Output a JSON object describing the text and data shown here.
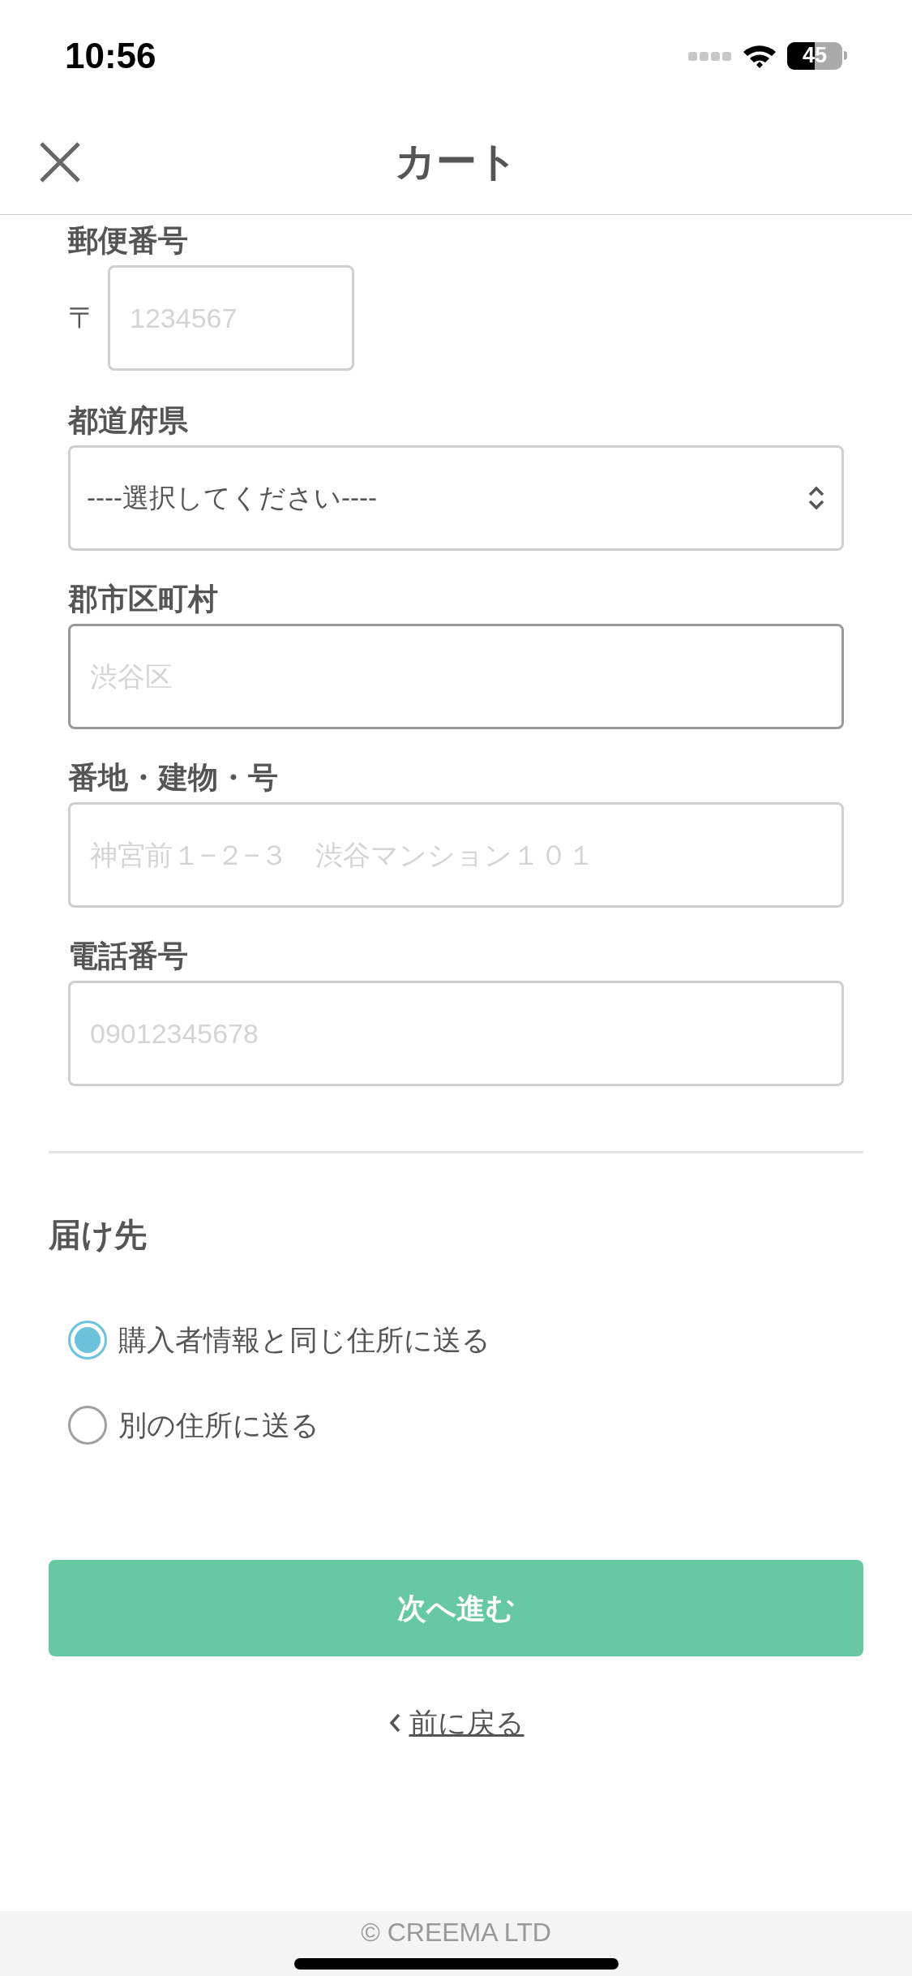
{
  "status_bar": {
    "time": "10:56",
    "battery": "45"
  },
  "nav": {
    "title": "カート"
  },
  "fields": [
    {
      "kind": "postal",
      "label": "郵便番号",
      "prefix": "〒",
      "placeholder": "1234567",
      "focused": false
    },
    {
      "kind": "select",
      "label": "都道府県",
      "value": "----選択してください----",
      "focused": false
    },
    {
      "kind": "text",
      "label": "郡市区町村",
      "placeholder": "渋谷区",
      "focused": true
    },
    {
      "kind": "text",
      "label": "番地・建物・号",
      "placeholder": "神宮前１−２−３　渋谷マンション１０１",
      "focused": false
    },
    {
      "kind": "text",
      "label": "電話番号",
      "placeholder": "09012345678",
      "focused": false
    }
  ],
  "destination": {
    "heading": "届け先",
    "options": [
      {
        "label": "購入者情報と同じ住所に送る",
        "selected": true
      },
      {
        "label": "別の住所に送る",
        "selected": false
      }
    ]
  },
  "next_button": "次へ進む",
  "back_link": "前に戻る",
  "footer": "© CREEMA LTD"
}
